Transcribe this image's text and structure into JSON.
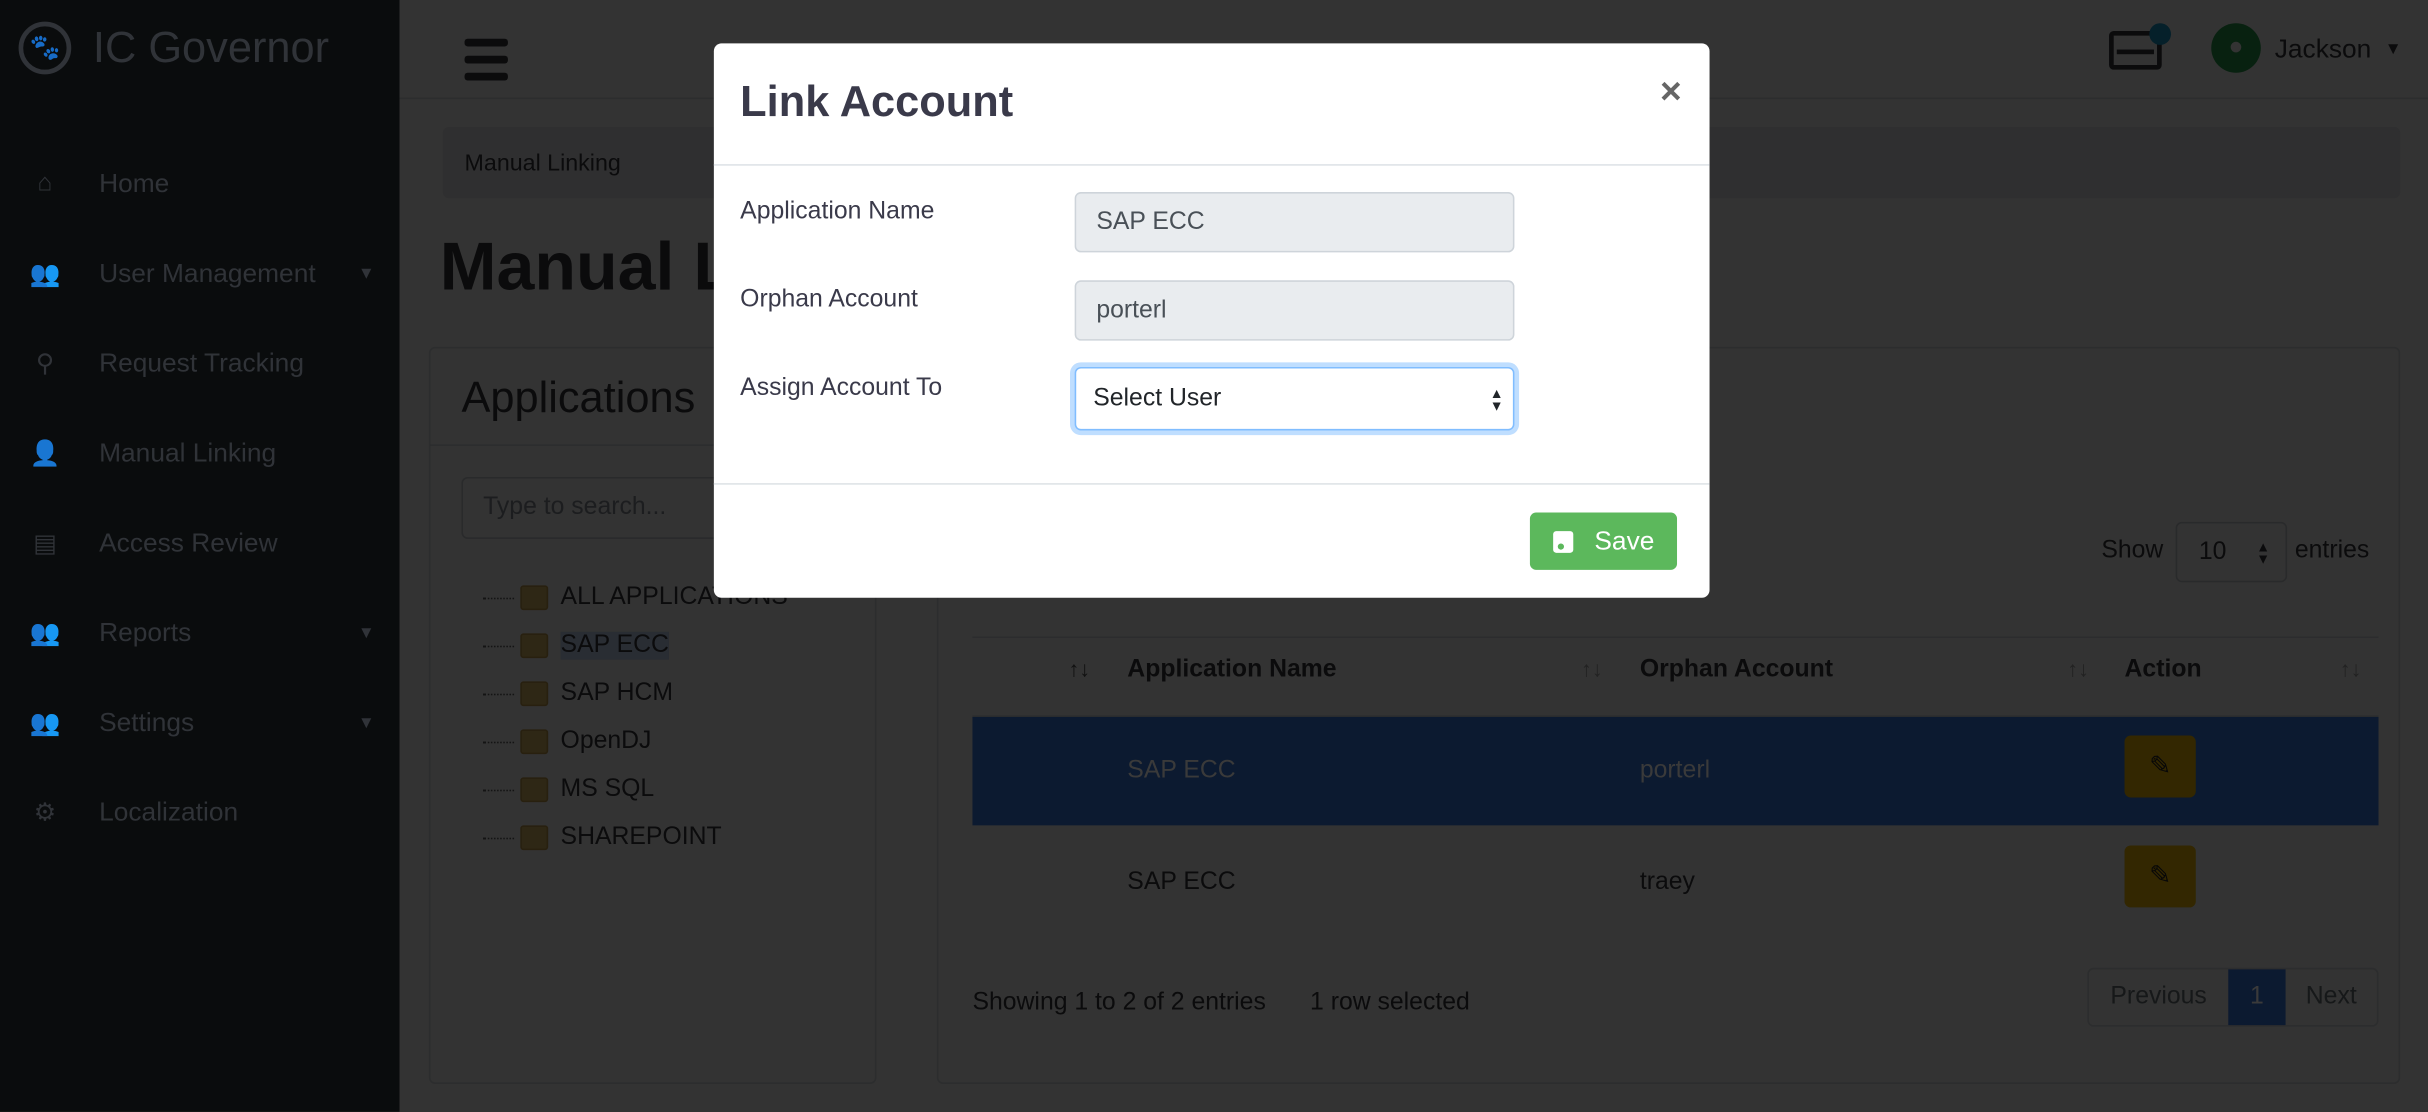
{
  "app": {
    "title": "IC Governor",
    "logo_icon": "paw-icon"
  },
  "sidebar": {
    "items": [
      {
        "label": "Home",
        "icon": "home-icon",
        "has_caret": false
      },
      {
        "label": "User Management",
        "icon": "users-icon",
        "has_caret": true
      },
      {
        "label": "Request Tracking",
        "icon": "search-icon",
        "has_caret": false
      },
      {
        "label": "Manual Linking",
        "icon": "user-icon",
        "has_caret": false
      },
      {
        "label": "Access Review",
        "icon": "clipboard-icon",
        "has_caret": false
      },
      {
        "label": "Reports",
        "icon": "users-icon",
        "has_caret": true
      },
      {
        "label": "Settings",
        "icon": "users-icon",
        "has_caret": true
      },
      {
        "label": "Localization",
        "icon": "gear-icon",
        "has_caret": false
      }
    ]
  },
  "topbar": {
    "user": "Jackson"
  },
  "breadcrumb": "Manual Linking",
  "page_title": "Manual Linking",
  "apps_panel": {
    "title": "Applications",
    "search_placeholder": "Type to search...",
    "tree": [
      "ALL APPLICATIONS",
      "SAP ECC",
      "SAP HCM",
      "OpenDJ",
      "MS SQL",
      "SHAREPOINT"
    ],
    "selected": "SAP ECC"
  },
  "table": {
    "show_label": "Show",
    "entries_value": "10",
    "entries_label": "entries",
    "headers": [
      "",
      "Application Name",
      "Orphan Account",
      "Action"
    ],
    "rows": [
      {
        "app": "SAP ECC",
        "account": "porterl",
        "selected": true
      },
      {
        "app": "SAP ECC",
        "account": "traey",
        "selected": false
      }
    ],
    "info": "Showing 1 to 2 of 2 entries",
    "selection_info": "1 row selected",
    "pagination": {
      "previous": "Previous",
      "current": "1",
      "next": "Next"
    }
  },
  "modal": {
    "title": "Link Account",
    "close": "×",
    "fields": [
      {
        "label": "Application Name",
        "value": "SAP ECC"
      },
      {
        "label": "Orphan Account",
        "value": "porterl"
      },
      {
        "label": "Assign Account To",
        "value": "Select User"
      }
    ],
    "save": "Save"
  },
  "colors": {
    "sidebar": "#343a40",
    "save": "#5cb85c",
    "edit": "#ffc107",
    "selected_row": "#3a80ec",
    "avatar": "#28a745",
    "badge": "#17a2b8"
  }
}
